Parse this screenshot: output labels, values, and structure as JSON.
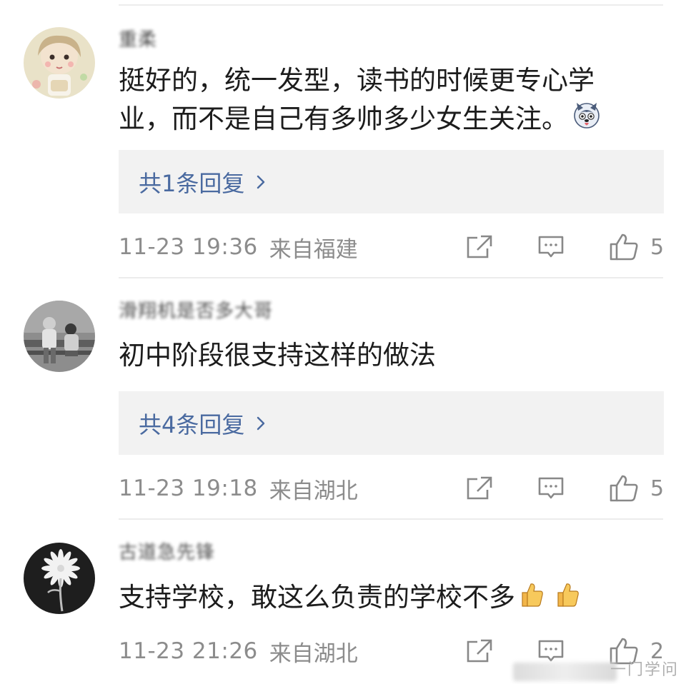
{
  "comments": [
    {
      "username": "重柔",
      "text_line1": "挺好的，统一发型，读书的时候更专心学",
      "text_line2": "业，而不是自己有多帅多少女生关注。",
      "emoji": "husky-emoji",
      "replies_label": "共1条回复",
      "time": "11-23 19:36",
      "location": "来自福建",
      "likes": "5"
    },
    {
      "username": "滑翔机是否多大哥",
      "text_line1": "初中阶段很支持这样的做法",
      "replies_label": "共4条回复",
      "time": "11-23 19:18",
      "location": "来自湖北",
      "likes": "5"
    },
    {
      "username": "古道急先锋",
      "text_line1": "支持学校，敢这么负责的学校不多",
      "emoji": "thumbs-up-emoji",
      "time": "11-23 21:26",
      "location": "来自湖北",
      "likes": "2"
    }
  ],
  "watermark": "一门学问",
  "colors": {
    "link": "#4a6aa0",
    "meta": "#8c8c8c",
    "reply_bg": "#f2f2f2",
    "divider": "#ececec"
  }
}
